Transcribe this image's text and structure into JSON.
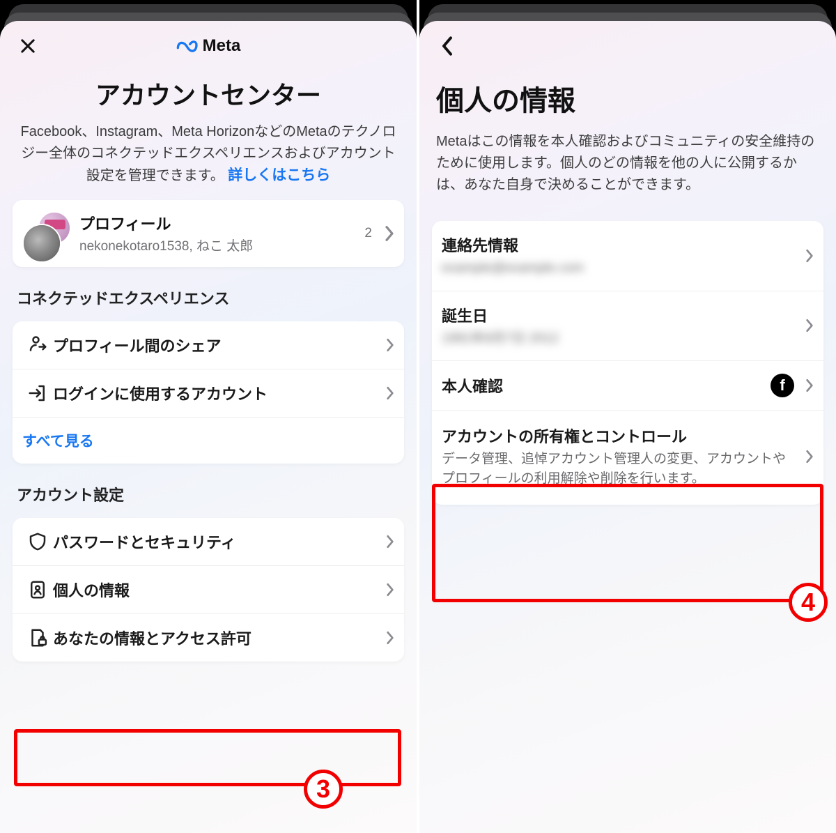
{
  "left": {
    "brand": "Meta",
    "title": "アカウントセンター",
    "description": "Facebook、Instagram、Meta HorizonなどのMetaのテクノロジー全体のコネクテッドエクスペリエンスおよびアカウント設定を管理できます。",
    "learn_more": "詳しくはこちら",
    "profile": {
      "heading": "プロフィール",
      "subtitle": "nekonekotaro1538, ねこ 太郎",
      "count": "2"
    },
    "section_connected": "コネクテッドエクスペリエンス",
    "connected": {
      "share": "プロフィール間のシェア",
      "login": "ログインに使用するアカウント",
      "see_all": "すべて見る"
    },
    "section_account": "アカウント設定",
    "account": {
      "security": "パスワードとセキュリティ",
      "personal": "個人の情報",
      "access": "あなたの情報とアクセス許可"
    },
    "step_badge": "3"
  },
  "right": {
    "title": "個人の情報",
    "description": "Metaはこの情報を本人確認およびコミュニティの安全維持のために使用します。個人のどの情報を他の人に公開するかは、あなた自身で決めることができます。",
    "items": {
      "contact_label": "連絡先情報",
      "contact_value": "example@example.com",
      "birthday_label": "誕生日",
      "birthday_value": "1991年8月7日 2012",
      "identity_label": "本人確認",
      "ownership_label": "アカウントの所有権とコントロール",
      "ownership_sub": "データ管理、追悼アカウント管理人の変更、アカウントやプロフィールの利用解除や削除を行います。"
    },
    "step_badge": "4"
  }
}
